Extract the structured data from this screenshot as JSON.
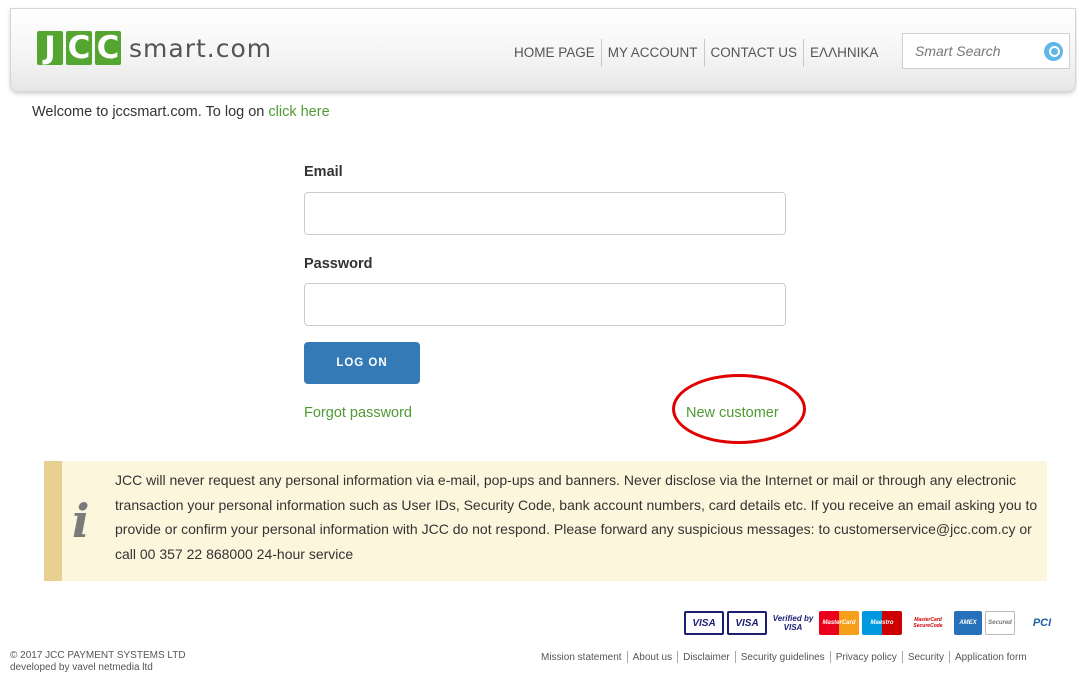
{
  "header": {
    "logo_letters": [
      "J",
      "C",
      "C"
    ],
    "logo_text": "smart.com",
    "nav": [
      "HOME PAGE",
      "MY ACCOUNT",
      "CONTACT US",
      "ΕΛΛΗΝΙΚΑ"
    ],
    "search_placeholder": "Smart Search",
    "search_icon": "search-icon"
  },
  "welcome": {
    "text": "Welcome to jccsmart.com. To log on ",
    "link": "click here"
  },
  "form": {
    "email_label": "Email",
    "email_value": "",
    "password_label": "Password",
    "password_value": "",
    "logon_label": "LOG ON",
    "forgot_label": "Forgot password",
    "new_customer_label": "New customer"
  },
  "notice": {
    "icon": "info-icon",
    "text": "JCC will never request any personal information via e-mail, pop-ups and banners. Never disclose via the Internet or mail or through any electronic transaction your personal information such as User IDs, Security Code, bank account numbers, card details etc. If you receive an email asking you to provide or confirm your personal information with JCC do not respond. Please forward any suspicious messages: to customerservice@jcc.com.cy or call 00 357 22 868000 24-hour service"
  },
  "footer": {
    "copyright_line1": "© 2017 JCC PAYMENT SYSTEMS LTD",
    "copyright_line2": "developed by vavel netmedia ltd",
    "links": [
      "Mission statement",
      "About us",
      "Disclaimer",
      "Security guidelines",
      "Privacy policy",
      "Security",
      "Application form"
    ],
    "card_logos": [
      "VISA",
      "VISA",
      "Verified by VISA",
      "MasterCard",
      "Maestro",
      "MasterCard SecureCode",
      "AMEX",
      "Secured",
      "PCI"
    ]
  },
  "colors": {
    "brand_green": "#55a630",
    "link_green": "#4f9a33",
    "button_blue": "#337ab7",
    "annotation_red": "#e00000",
    "notice_bg": "#fcf6dc"
  }
}
